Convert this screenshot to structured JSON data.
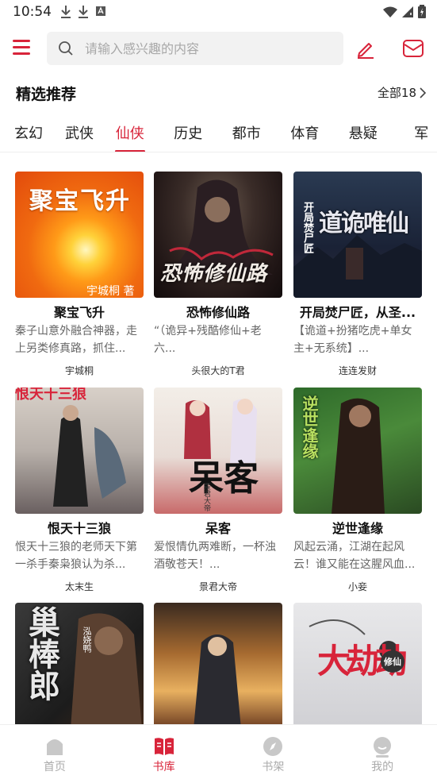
{
  "status_bar": {
    "time": "10:54"
  },
  "search": {
    "placeholder": "请输入感兴趣的内容"
  },
  "section": {
    "title": "精选推荐",
    "see_all": "全部18"
  },
  "tabs": [
    {
      "label": "玄幻"
    },
    {
      "label": "武侠"
    },
    {
      "label": "仙侠"
    },
    {
      "label": "历史"
    },
    {
      "label": "都市"
    },
    {
      "label": "体育"
    },
    {
      "label": "悬疑"
    },
    {
      "label": "军"
    }
  ],
  "active_tab": "仙侠",
  "books": [
    {
      "title": "聚宝飞升",
      "desc": "秦子山意外融合神器，走上另类修真路，抓住...",
      "author": "宇城桐",
      "cover_text": "聚宝飞升",
      "cover_sub": "宇城桐 著"
    },
    {
      "title": "恐怖修仙路",
      "desc": "“（诡异+残酷修仙+老六...",
      "author": "头很大的T君",
      "cover_text": "恐怖修仙路",
      "cover_sub": ""
    },
    {
      "title": "开局焚尸匠，从圣...",
      "desc": "【诡道+扮猪吃虎+单女主+无系统】...",
      "author": "连连发财",
      "cover_text": "道诡唯仙",
      "cover_sub": "开局焚尸匠"
    },
    {
      "title": "恨天十三狼",
      "desc": "恨天十三狼的老师天下第一杀手秦枭狼认为杀...",
      "author": "太末生",
      "cover_text": "恨天十三狼",
      "cover_sub": ""
    },
    {
      "title": "呆客",
      "desc": "爱恨情仇两难断，一杯浊酒敬苍天！...",
      "author": "景君大帝",
      "cover_text": "呆客",
      "cover_sub": "景君大帝"
    },
    {
      "title": "逆世逢缘",
      "desc": "风起云涌，江湖在起风云！谁又能在这腥风血...",
      "author": "小妾",
      "cover_text": "逆世逢缘",
      "cover_sub": ""
    },
    {
      "title": "",
      "desc": "",
      "author": "",
      "cover_text": "巢棒郎",
      "cover_sub": "泓娆鸭"
    },
    {
      "title": "",
      "desc": "",
      "author": "",
      "cover_text": "",
      "cover_sub": ""
    },
    {
      "title": "",
      "desc": "",
      "author": "",
      "cover_text": "大劫劫",
      "cover_sub": "修仙"
    }
  ],
  "bottom_nav": [
    {
      "label": "首页",
      "icon": "home-icon"
    },
    {
      "label": "书库",
      "icon": "library-book-icon"
    },
    {
      "label": "书架",
      "icon": "compass-icon"
    },
    {
      "label": "我的",
      "icon": "profile-icon"
    }
  ],
  "colors": {
    "accent": "#d8243a",
    "muted": "#aaaaaa"
  }
}
